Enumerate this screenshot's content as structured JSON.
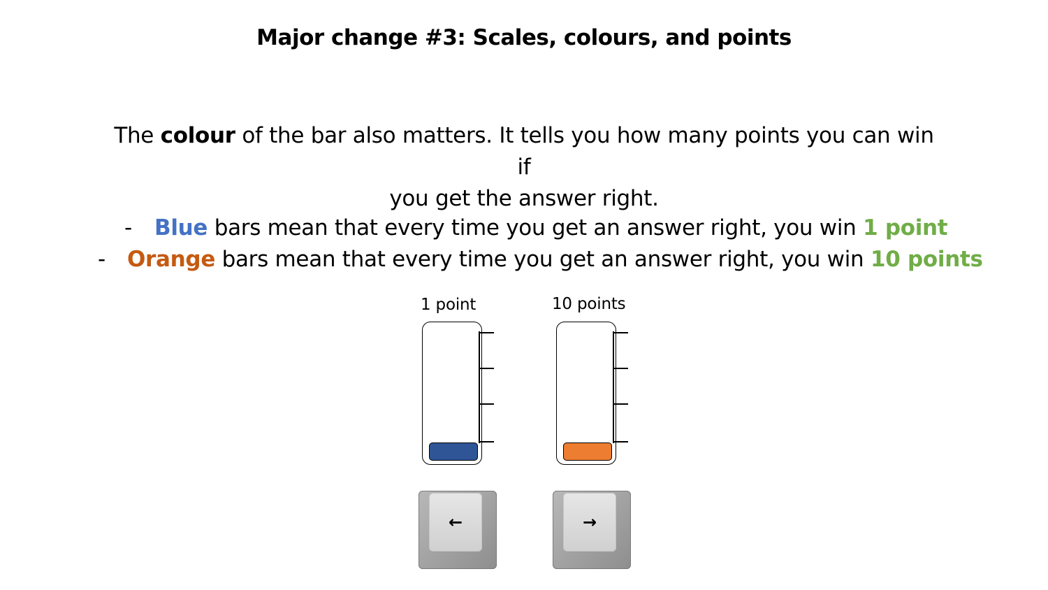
{
  "title": "Major change #3: Scales, colours, and points",
  "intro": {
    "prefix": "The ",
    "emphasis": "colour",
    "rest_line1": " of the bar also matters. It tells you how many points you can win if",
    "line2": "you get the answer right."
  },
  "bullets": [
    {
      "dash": "-",
      "color_word": "Blue",
      "middle": " bars mean that every time you get an answer right, you win ",
      "points_text": "1 point"
    },
    {
      "dash": "-",
      "color_word": "Orange",
      "middle": " bars mean that every time you get an answer right, you win ",
      "points_text": "10 points"
    }
  ],
  "bars": [
    {
      "label": "1 point",
      "fill_color": "#2f5597",
      "key_arrow": "←"
    },
    {
      "label": "10 points",
      "fill_color": "#ed7d31",
      "key_arrow": "→"
    }
  ],
  "colors": {
    "blue_text": "#4472c4",
    "orange_text": "#c55a11",
    "green_text": "#70ad47"
  },
  "icons": [
    "left-arrow-key-icon",
    "right-arrow-key-icon"
  ]
}
